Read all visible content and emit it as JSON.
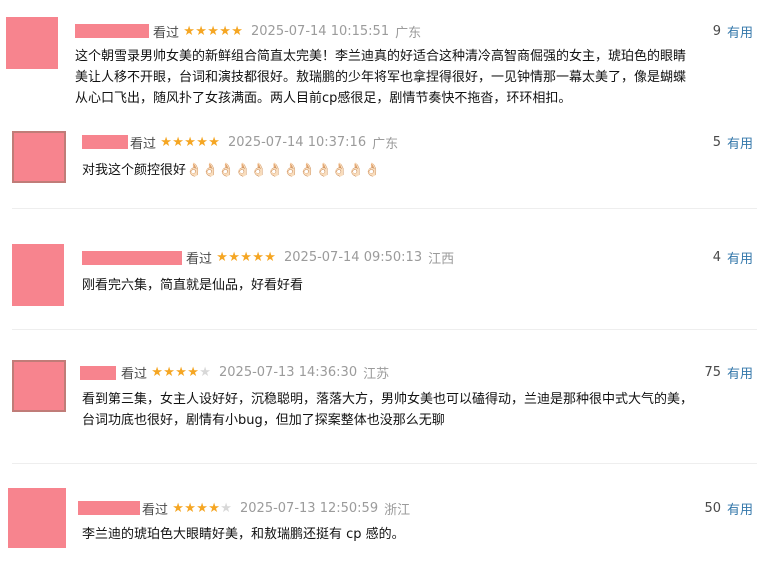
{
  "comments": [
    {
      "watched_label": "看过",
      "stars": [
        "on",
        "on",
        "on",
        "on",
        "on"
      ],
      "time": "2025-07-14 10:15:51",
      "location": "广东",
      "vote_count": "9",
      "useful_label": "有用",
      "lines": [
        "这个朝雪录男帅女美的新鲜组合简直太完美！李兰迪真的好适合这种清冷高智商倔强的女主，琥珀色的眼睛",
        "美让人移不开眼，台词和演技都很好。敖瑞鹏的少年将军也拿捏得很好，一见钟情那一幕太美了，像是蝴蝶",
        "从心口飞出，随风扑了女孩满面。两人目前cp感很足，剧情节奏快不拖沓，环环相扣。"
      ]
    },
    {
      "watched_label": "看过",
      "stars": [
        "on",
        "on",
        "on",
        "on",
        "on"
      ],
      "time": "2025-07-14 10:37:16",
      "location": "广东",
      "vote_count": "5",
      "useful_label": "有用",
      "lines": [
        "对我这个颜控很好👌🏻👌🏻👌🏻👌🏻👌🏻👌🏻👌🏻👌🏻👌🏻👌🏻👌🏻👌🏻"
      ]
    },
    {
      "watched_label": "看过",
      "stars": [
        "on",
        "on",
        "on",
        "on",
        "on"
      ],
      "time": "2025-07-14 09:50:13",
      "location": "江西",
      "vote_count": "4",
      "useful_label": "有用",
      "lines": [
        "刚看完六集，简直就是仙品，好看好看"
      ]
    },
    {
      "watched_label": "看过",
      "stars": [
        "on",
        "on",
        "on",
        "on",
        "off"
      ],
      "time": "2025-07-13 14:36:30",
      "location": "江苏",
      "vote_count": "75",
      "useful_label": "有用",
      "lines": [
        "看到第三集，女主人设好好，沉稳聪明，落落大方，男帅女美也可以磕得动，兰迪是那种很中式大气的美，",
        "台词功底也很好，剧情有小bug，但加了探案整体也没那么无聊"
      ]
    },
    {
      "watched_label": "看过",
      "stars": [
        "on",
        "on",
        "on",
        "on",
        "off"
      ],
      "time": "2025-07-13 12:50:59",
      "location": "浙江",
      "vote_count": "50",
      "useful_label": "有用",
      "lines": [
        "李兰迪的琥珀色大眼睛好美，和敖瑞鹏还挺有 cp 感的。"
      ]
    }
  ]
}
